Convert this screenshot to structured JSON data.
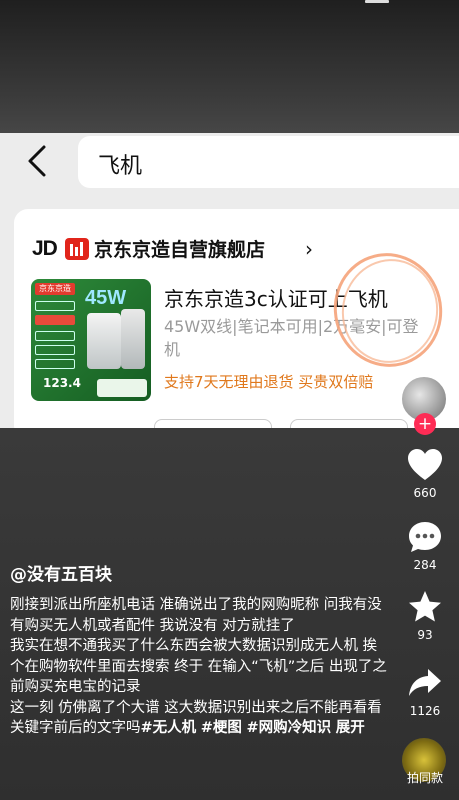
{
  "screenshot": {
    "search": {
      "query": "飞机"
    },
    "store": {
      "logo": "JD",
      "name": "京东京造自营旗舰店",
      "chevron": "›"
    },
    "thumbnail": {
      "brand": "京东京造",
      "capacity_label": "45W",
      "price": "123.4"
    },
    "product": {
      "title": "京东京造3c认证可上飞机",
      "subtitle": "45W双线|笔记本可用|2万毫安|可登机",
      "service": "支持7天无理由退货   买贵双倍赔"
    }
  },
  "actions": {
    "likes": "660",
    "comments": "284",
    "favorites": "93",
    "shares": "1126",
    "music_label": "拍同款"
  },
  "post": {
    "username": "@没有五百块",
    "caption": "刚接到派出所座机电话  准确说出了我的网购昵称  问我有没有购买无人机或者配件  我说没有  对方就挂了\n  我实在想不通我买了什么东西会被大数据识别成无人机  挨个在购物软件里面去搜索  终于  在输入“飞机”之后  出现了之前购买充电宝的记录\n这一刻  仿佛离了个大谱  这大数据识别出来之后不能再看看关键字前后的文字吗",
    "hashtags": [
      "#无人机",
      "#梗图",
      "#网购冷知识"
    ],
    "expand": "展开"
  }
}
